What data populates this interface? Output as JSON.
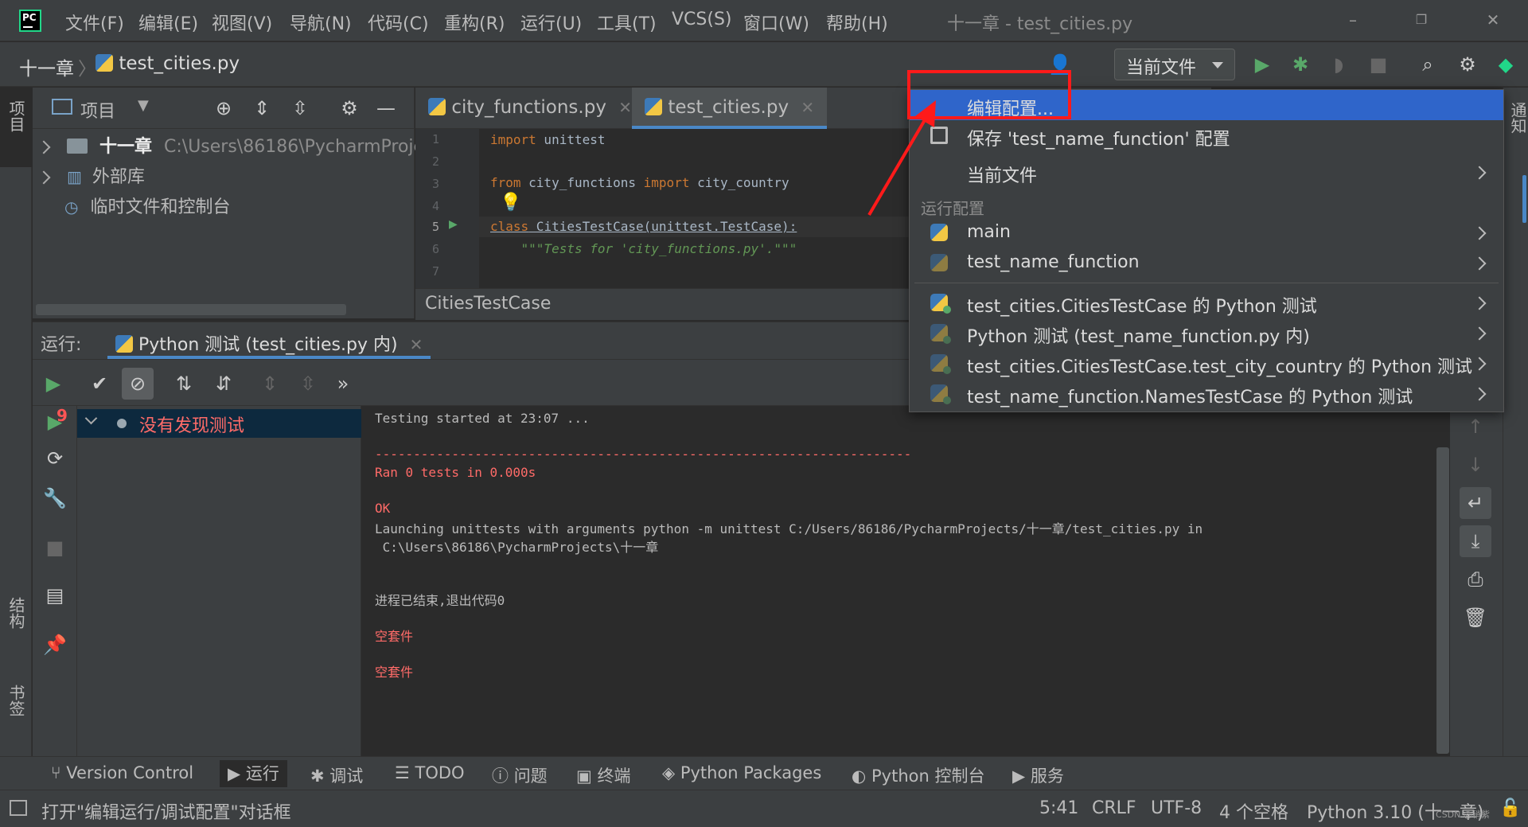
{
  "app": {
    "logo_text": "PC",
    "window_title": "十一章 - test_cities.py",
    "menu": [
      "文件(F)",
      "编辑(E)",
      "视图(V)",
      "导航(N)",
      "代码(C)",
      "重构(R)",
      "运行(U)",
      "工具(T)",
      "VCS(S)",
      "窗口(W)",
      "帮助(H)"
    ]
  },
  "navbar": {
    "project": "十一章",
    "file": "test_cities.py",
    "run_config": "当前文件"
  },
  "left_stripe": {
    "project_tab": "项目",
    "structure_tab": "结构",
    "bookmarks_tab": "书签"
  },
  "right_stripe": {
    "notifications_tab": "通知"
  },
  "project_panel": {
    "title": "项目",
    "root_name": "十一章",
    "root_path": "C:\\Users\\86186\\PycharmProjec",
    "external_libs": "外部库",
    "scratches": "临时文件和控制台"
  },
  "editor": {
    "tabs": [
      {
        "label": "city_functions.py"
      },
      {
        "label": "test_cities.py"
      }
    ],
    "line_numbers": [
      "1",
      "2",
      "3",
      "4",
      "5",
      "6",
      "7"
    ],
    "code": {
      "l1_kw": "import",
      "l1_rest": " unittest",
      "l3_kw1": "from",
      "l3_mid": " city_functions ",
      "l3_kw2": "import",
      "l3_rest": " city_country",
      "l5_kw": "class",
      "l5_rest": " CitiesTestCase(unittest.TestCase):",
      "l6_doc": "    \"\"\"Tests for 'city_functions.py'.\"\"\""
    },
    "breadcrumb": "CitiesTestCase"
  },
  "run_panel": {
    "label": "运行:",
    "tab": "Python 测试 (test_cities.py 内)",
    "badge_count": "9",
    "test_tree_item": "没有发现测试",
    "console": [
      {
        "text": "Testing started at 23:07 ...",
        "err": false
      },
      {
        "text": "",
        "err": false
      },
      {
        "text": "----------------------------------------------------------------------",
        "err": true
      },
      {
        "text": "Ran 0 tests in 0.000s",
        "err": true
      },
      {
        "text": "",
        "err": false
      },
      {
        "text": "OK",
        "err": true
      },
      {
        "text": "Launching unittests with arguments python -m unittest C:/Users/86186/PycharmProjects/十一章/test_cities.py in",
        "err": false
      },
      {
        "text": " C:\\Users\\86186\\PycharmProjects\\十一章",
        "err": false
      },
      {
        "text": "",
        "err": false
      },
      {
        "text": "",
        "err": false
      },
      {
        "text": "进程已结束,退出代码0",
        "err": false
      },
      {
        "text": "",
        "err": false
      },
      {
        "text": "空套件",
        "err": true
      },
      {
        "text": "",
        "err": false
      },
      {
        "text": "空套件",
        "err": true
      }
    ]
  },
  "bottom_tools": [
    "Version Control",
    "运行",
    "调试",
    "TODO",
    "问题",
    "终端",
    "Python Packages",
    "Python 控制台",
    "服务"
  ],
  "status_bar": {
    "message": "打开\"编辑运行/调试配置\"对话框",
    "position": "5:41",
    "line_sep": "CRLF",
    "encoding": "UTF-8",
    "indent": "4 个空格",
    "interpreter": "Python 3.10 (十一章)"
  },
  "popup": {
    "edit_config": "编辑配置...",
    "save_config": "保存 'test_name_function' 配置",
    "current_file": "当前文件",
    "section_title": "运行配置",
    "configs": [
      "main",
      "test_name_function",
      "test_cities.CitiesTestCase 的 Python 测试",
      "Python 测试 (test_name_function.py 内)",
      "test_cities.CitiesTestCase.test_city_country 的 Python 测试",
      "test_name_function.NamesTestCase 的 Python 测试"
    ]
  },
  "colors": {
    "background": "#2b2b2b",
    "panel": "#3c3f41",
    "selection": "#2f65ca",
    "error_text": "#ff6b68",
    "run_green": "#59a869",
    "annotation_red": "#ff1a1a"
  },
  "watermark": "CSDN @稍紫"
}
